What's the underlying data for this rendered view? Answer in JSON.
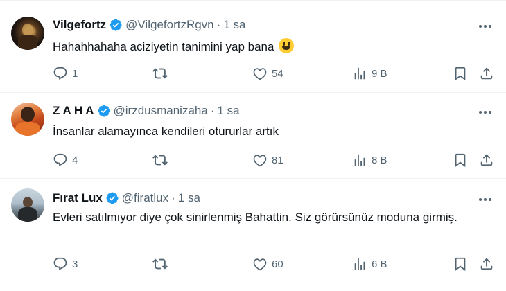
{
  "tweets": [
    {
      "name": "Vilgefortz",
      "handle": "@VilgefortzRgvn",
      "separator": "·",
      "time": "1 sa",
      "text": "Hahahhahaha aciziyetin tanimini yap bana",
      "emoji": "grinning-face",
      "replies": "1",
      "retweets": "",
      "likes": "54",
      "views": "9 B"
    },
    {
      "name": "Z A H A",
      "handle": "@irzdusmanizaha",
      "separator": "·",
      "time": "1 sa",
      "text": "İnsanlar alamayınca kendileri otururlar artık",
      "replies": "4",
      "retweets": "",
      "likes": "81",
      "views": "8 B"
    },
    {
      "name": "Fırat Lux",
      "handle": "@firatlux",
      "separator": "·",
      "time": "1 sa",
      "text": "Evleri satılmıyor diye çok sinirlenmiş Bahattin. Siz görürsünüz moduna girmiş.",
      "replies": "3",
      "retweets": "",
      "likes": "60",
      "views": "6 B"
    }
  ],
  "colors": {
    "verified": "#1d9bf0",
    "icon": "#536471",
    "text": "#0f1419",
    "divider": "#eff3f4"
  },
  "icons": [
    "verified-badge-icon",
    "more-icon",
    "reply-icon",
    "retweet-icon",
    "like-icon",
    "views-icon",
    "bookmark-icon",
    "share-icon"
  ]
}
